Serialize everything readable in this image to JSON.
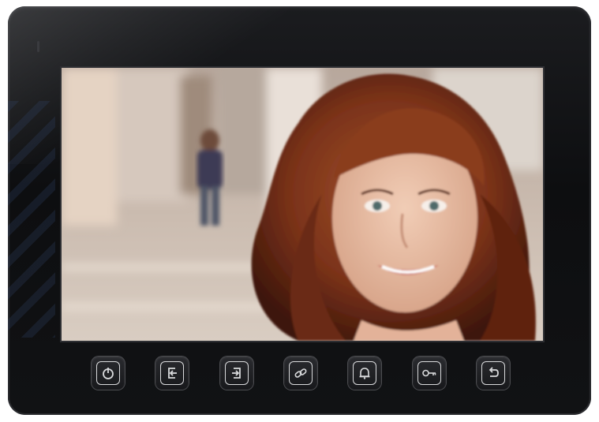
{
  "device": {
    "name": "video-intercom-monitor",
    "accent": "#d9dadc",
    "body_color": "#111214"
  },
  "screen": {
    "content": "live-video-feed"
  },
  "buttons": [
    {
      "icon": "power-icon"
    },
    {
      "icon": "enter-icon"
    },
    {
      "icon": "exit-icon"
    },
    {
      "icon": "link-icon"
    },
    {
      "icon": "bell-icon"
    },
    {
      "icon": "key-icon"
    },
    {
      "icon": "back-icon"
    }
  ]
}
